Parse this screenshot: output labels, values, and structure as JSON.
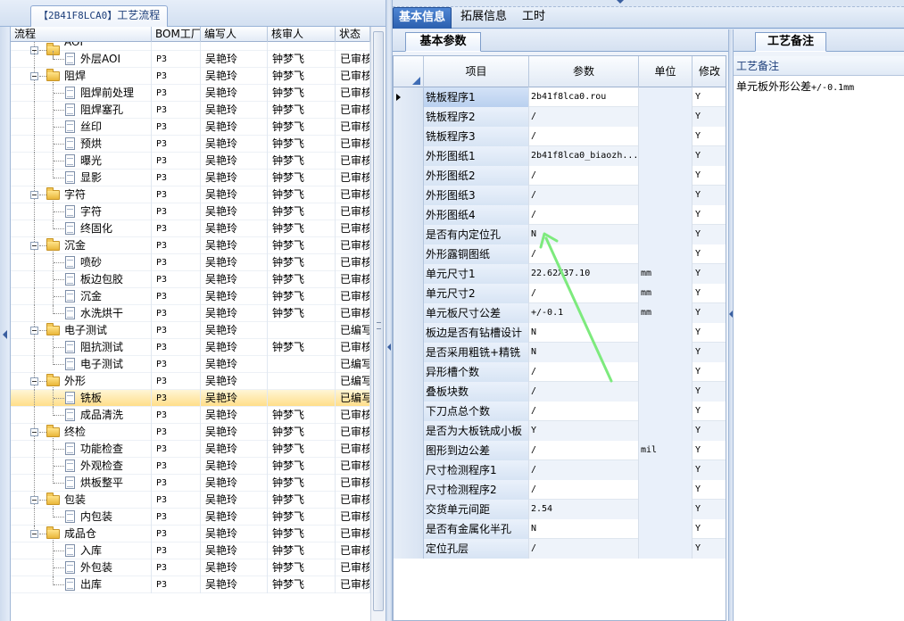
{
  "left_panel": {
    "tab_code": "【2B41F8LCA0】",
    "tab_label": "工艺流程",
    "columns": [
      "流程",
      "BOM工厂",
      "编写人",
      "核审人",
      "状态"
    ],
    "rows": [
      {
        "level": 0,
        "type": "folder",
        "label": "AOI",
        "factory": "",
        "author": "",
        "reviewer": "",
        "status": "",
        "partial": true
      },
      {
        "level": 1,
        "type": "item",
        "label": "外层AOI",
        "factory": "P3",
        "author": "吴艳玲",
        "reviewer": "钟梦飞",
        "status": "已审核",
        "last": true
      },
      {
        "level": 0,
        "type": "folder",
        "label": "阻焊",
        "factory": "P3",
        "author": "吴艳玲",
        "reviewer": "钟梦飞",
        "status": "已审核"
      },
      {
        "level": 1,
        "type": "item",
        "label": "阻焊前处理",
        "factory": "P3",
        "author": "吴艳玲",
        "reviewer": "钟梦飞",
        "status": "已审核"
      },
      {
        "level": 1,
        "type": "item",
        "label": "阻焊塞孔",
        "factory": "P3",
        "author": "吴艳玲",
        "reviewer": "钟梦飞",
        "status": "已审核"
      },
      {
        "level": 1,
        "type": "item",
        "label": "丝印",
        "factory": "P3",
        "author": "吴艳玲",
        "reviewer": "钟梦飞",
        "status": "已审核"
      },
      {
        "level": 1,
        "type": "item",
        "label": "预烘",
        "factory": "P3",
        "author": "吴艳玲",
        "reviewer": "钟梦飞",
        "status": "已审核"
      },
      {
        "level": 1,
        "type": "item",
        "label": "曝光",
        "factory": "P3",
        "author": "吴艳玲",
        "reviewer": "钟梦飞",
        "status": "已审核"
      },
      {
        "level": 1,
        "type": "item",
        "label": "显影",
        "factory": "P3",
        "author": "吴艳玲",
        "reviewer": "钟梦飞",
        "status": "已审核",
        "last": true
      },
      {
        "level": 0,
        "type": "folder",
        "label": "字符",
        "factory": "P3",
        "author": "吴艳玲",
        "reviewer": "钟梦飞",
        "status": "已审核"
      },
      {
        "level": 1,
        "type": "item",
        "label": "字符",
        "factory": "P3",
        "author": "吴艳玲",
        "reviewer": "钟梦飞",
        "status": "已审核"
      },
      {
        "level": 1,
        "type": "item",
        "label": "终固化",
        "factory": "P3",
        "author": "吴艳玲",
        "reviewer": "钟梦飞",
        "status": "已审核",
        "last": true
      },
      {
        "level": 0,
        "type": "folder",
        "label": "沉金",
        "factory": "P3",
        "author": "吴艳玲",
        "reviewer": "钟梦飞",
        "status": "已审核"
      },
      {
        "level": 1,
        "type": "item",
        "label": "喷砂",
        "factory": "P3",
        "author": "吴艳玲",
        "reviewer": "钟梦飞",
        "status": "已审核"
      },
      {
        "level": 1,
        "type": "item",
        "label": "板边包胶",
        "factory": "P3",
        "author": "吴艳玲",
        "reviewer": "钟梦飞",
        "status": "已审核"
      },
      {
        "level": 1,
        "type": "item",
        "label": "沉金",
        "factory": "P3",
        "author": "吴艳玲",
        "reviewer": "钟梦飞",
        "status": "已审核"
      },
      {
        "level": 1,
        "type": "item",
        "label": "水洗烘干",
        "factory": "P3",
        "author": "吴艳玲",
        "reviewer": "钟梦飞",
        "status": "已审核",
        "last": true
      },
      {
        "level": 0,
        "type": "folder",
        "label": "电子测试",
        "factory": "P3",
        "author": "吴艳玲",
        "reviewer": "",
        "status": "已编写"
      },
      {
        "level": 1,
        "type": "item",
        "label": "阻抗测试",
        "factory": "P3",
        "author": "吴艳玲",
        "reviewer": "钟梦飞",
        "status": "已审核"
      },
      {
        "level": 1,
        "type": "item",
        "label": "电子测试",
        "factory": "P3",
        "author": "吴艳玲",
        "reviewer": "",
        "status": "已编写",
        "last": true
      },
      {
        "level": 0,
        "type": "folder",
        "label": "外形",
        "factory": "P3",
        "author": "吴艳玲",
        "reviewer": "",
        "status": "已编写"
      },
      {
        "level": 1,
        "type": "item",
        "label": "铣板",
        "factory": "P3",
        "author": "吴艳玲",
        "reviewer": "",
        "status": "已编写",
        "selected": true
      },
      {
        "level": 1,
        "type": "item",
        "label": "成品清洗",
        "factory": "P3",
        "author": "吴艳玲",
        "reviewer": "钟梦飞",
        "status": "已审核",
        "last": true
      },
      {
        "level": 0,
        "type": "folder",
        "label": "终检",
        "factory": "P3",
        "author": "吴艳玲",
        "reviewer": "钟梦飞",
        "status": "已审核"
      },
      {
        "level": 1,
        "type": "item",
        "label": "功能检查",
        "factory": "P3",
        "author": "吴艳玲",
        "reviewer": "钟梦飞",
        "status": "已审核"
      },
      {
        "level": 1,
        "type": "item",
        "label": "外观检查",
        "factory": "P3",
        "author": "吴艳玲",
        "reviewer": "钟梦飞",
        "status": "已审核"
      },
      {
        "level": 1,
        "type": "item",
        "label": "烘板整平",
        "factory": "P3",
        "author": "吴艳玲",
        "reviewer": "钟梦飞",
        "status": "已审核",
        "last": true
      },
      {
        "level": 0,
        "type": "folder",
        "label": "包装",
        "factory": "P3",
        "author": "吴艳玲",
        "reviewer": "钟梦飞",
        "status": "已审核"
      },
      {
        "level": 1,
        "type": "item",
        "label": "内包装",
        "factory": "P3",
        "author": "吴艳玲",
        "reviewer": "钟梦飞",
        "status": "已审核",
        "last": true
      },
      {
        "level": 0,
        "type": "folder",
        "label": "成品仓",
        "factory": "P3",
        "author": "吴艳玲",
        "reviewer": "钟梦飞",
        "status": "已审核",
        "lastFolder": true
      },
      {
        "level": 1,
        "type": "item",
        "label": "入库",
        "factory": "P3",
        "author": "吴艳玲",
        "reviewer": "钟梦飞",
        "status": "已审核"
      },
      {
        "level": 1,
        "type": "item",
        "label": "外包装",
        "factory": "P3",
        "author": "吴艳玲",
        "reviewer": "钟梦飞",
        "status": "已审核"
      },
      {
        "level": 1,
        "type": "item",
        "label": "出库",
        "factory": "P3",
        "author": "吴艳玲",
        "reviewer": "钟梦飞",
        "status": "已审核",
        "last": true
      }
    ]
  },
  "main_tabs": [
    {
      "label": "基本信息",
      "active": true
    },
    {
      "label": "拓展信息",
      "active": false
    },
    {
      "label": "工时",
      "active": false
    }
  ],
  "basic_params": {
    "sub_tab": "基本参数",
    "columns": [
      "项目",
      "参数",
      "单位",
      "修改"
    ],
    "rows": [
      {
        "item": "铣板程序1",
        "value": "2b41f8lca0.rou",
        "unit": "",
        "modify": "Y",
        "current": true
      },
      {
        "item": "铣板程序2",
        "value": "/",
        "unit": "",
        "modify": "Y"
      },
      {
        "item": "铣板程序3",
        "value": "/",
        "unit": "",
        "modify": "Y"
      },
      {
        "item": "外形图纸1",
        "value": "2b41f8lca0_biaozh...",
        "unit": "",
        "modify": "Y"
      },
      {
        "item": "外形图纸2",
        "value": "/",
        "unit": "",
        "modify": "Y"
      },
      {
        "item": "外形图纸3",
        "value": "/",
        "unit": "",
        "modify": "Y"
      },
      {
        "item": "外形图纸4",
        "value": "/",
        "unit": "",
        "modify": "Y"
      },
      {
        "item": "是否有内定位孔",
        "value": "N",
        "unit": "",
        "modify": "Y"
      },
      {
        "item": "外形露铜图纸",
        "value": "/",
        "unit": "",
        "modify": "Y"
      },
      {
        "item": "单元尺寸1",
        "value": "22.62X37.10",
        "unit": "mm",
        "modify": "Y"
      },
      {
        "item": "单元尺寸2",
        "value": "/",
        "unit": "mm",
        "modify": "Y"
      },
      {
        "item": "单元板尺寸公差",
        "value": "+/-0.1",
        "unit": "mm",
        "modify": "Y"
      },
      {
        "item": "板边是否有钻槽设计",
        "value": "N",
        "unit": "",
        "modify": "Y"
      },
      {
        "item": "是否采用粗铣+精铣",
        "value": "N",
        "unit": "",
        "modify": "Y"
      },
      {
        "item": "异形槽个数",
        "value": "/",
        "unit": "",
        "modify": "Y"
      },
      {
        "item": "叠板块数",
        "value": "/",
        "unit": "",
        "modify": "Y"
      },
      {
        "item": "下刀点总个数",
        "value": "/",
        "unit": "",
        "modify": "Y"
      },
      {
        "item": "是否为大板铣成小板",
        "value": "Y",
        "unit": "",
        "modify": "Y"
      },
      {
        "item": "图形到边公差",
        "value": "/",
        "unit": "mil",
        "modify": "Y"
      },
      {
        "item": "尺寸检测程序1",
        "value": "/",
        "unit": "",
        "modify": "Y"
      },
      {
        "item": "尺寸检测程序2",
        "value": "/",
        "unit": "",
        "modify": "Y"
      },
      {
        "item": "交货单元间距",
        "value": "2.54",
        "unit": "",
        "modify": "Y"
      },
      {
        "item": "是否有金属化半孔",
        "value": "N",
        "unit": "",
        "modify": "Y"
      },
      {
        "item": "定位孔层",
        "value": "/",
        "unit": "",
        "modify": "Y"
      }
    ]
  },
  "remark_panel": {
    "tab_label": "工艺备注",
    "title": "工艺备注",
    "text_prefix": "单元板外形公差",
    "text_value": "+/-0.1mm"
  },
  "colors": {
    "annotation_arrow": "#7dea7d",
    "selected_row": "#ffde8a",
    "active_tab": "#2b5fae"
  }
}
